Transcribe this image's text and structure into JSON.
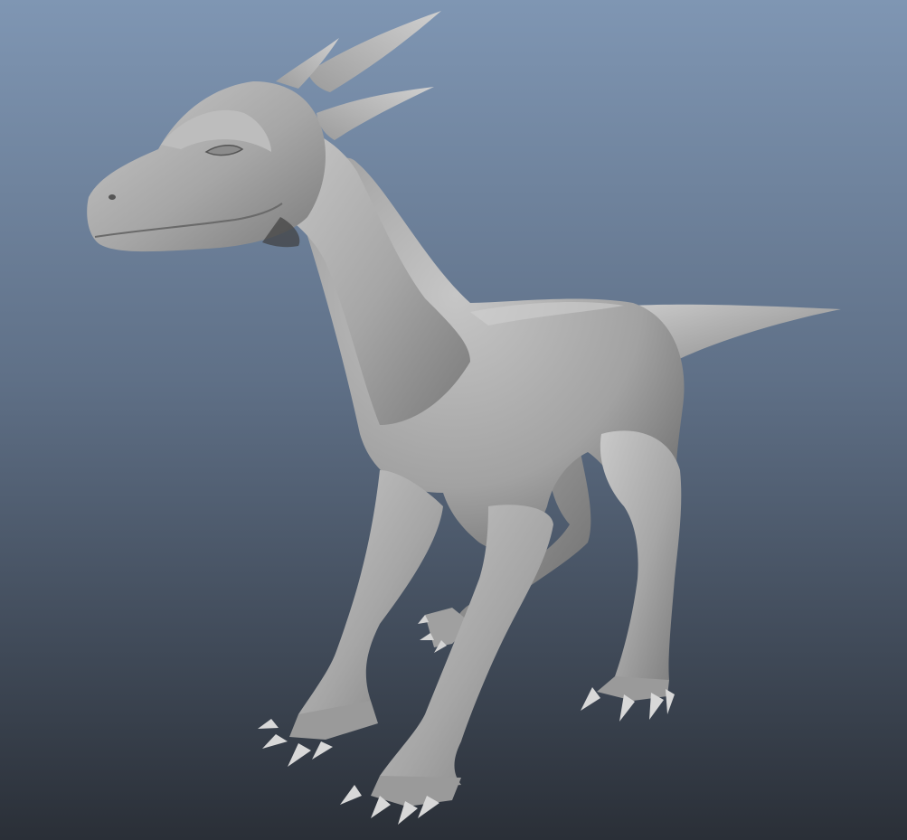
{
  "viewport": {
    "background_top": "#7f96b3",
    "background_mid": "#5f7087",
    "background_bottom": "#2a2f37",
    "model_base": "#9a9a9a",
    "model_light": "#c8c8c8",
    "model_shadow": "#5a5a5a",
    "subject": "dragon-model"
  }
}
